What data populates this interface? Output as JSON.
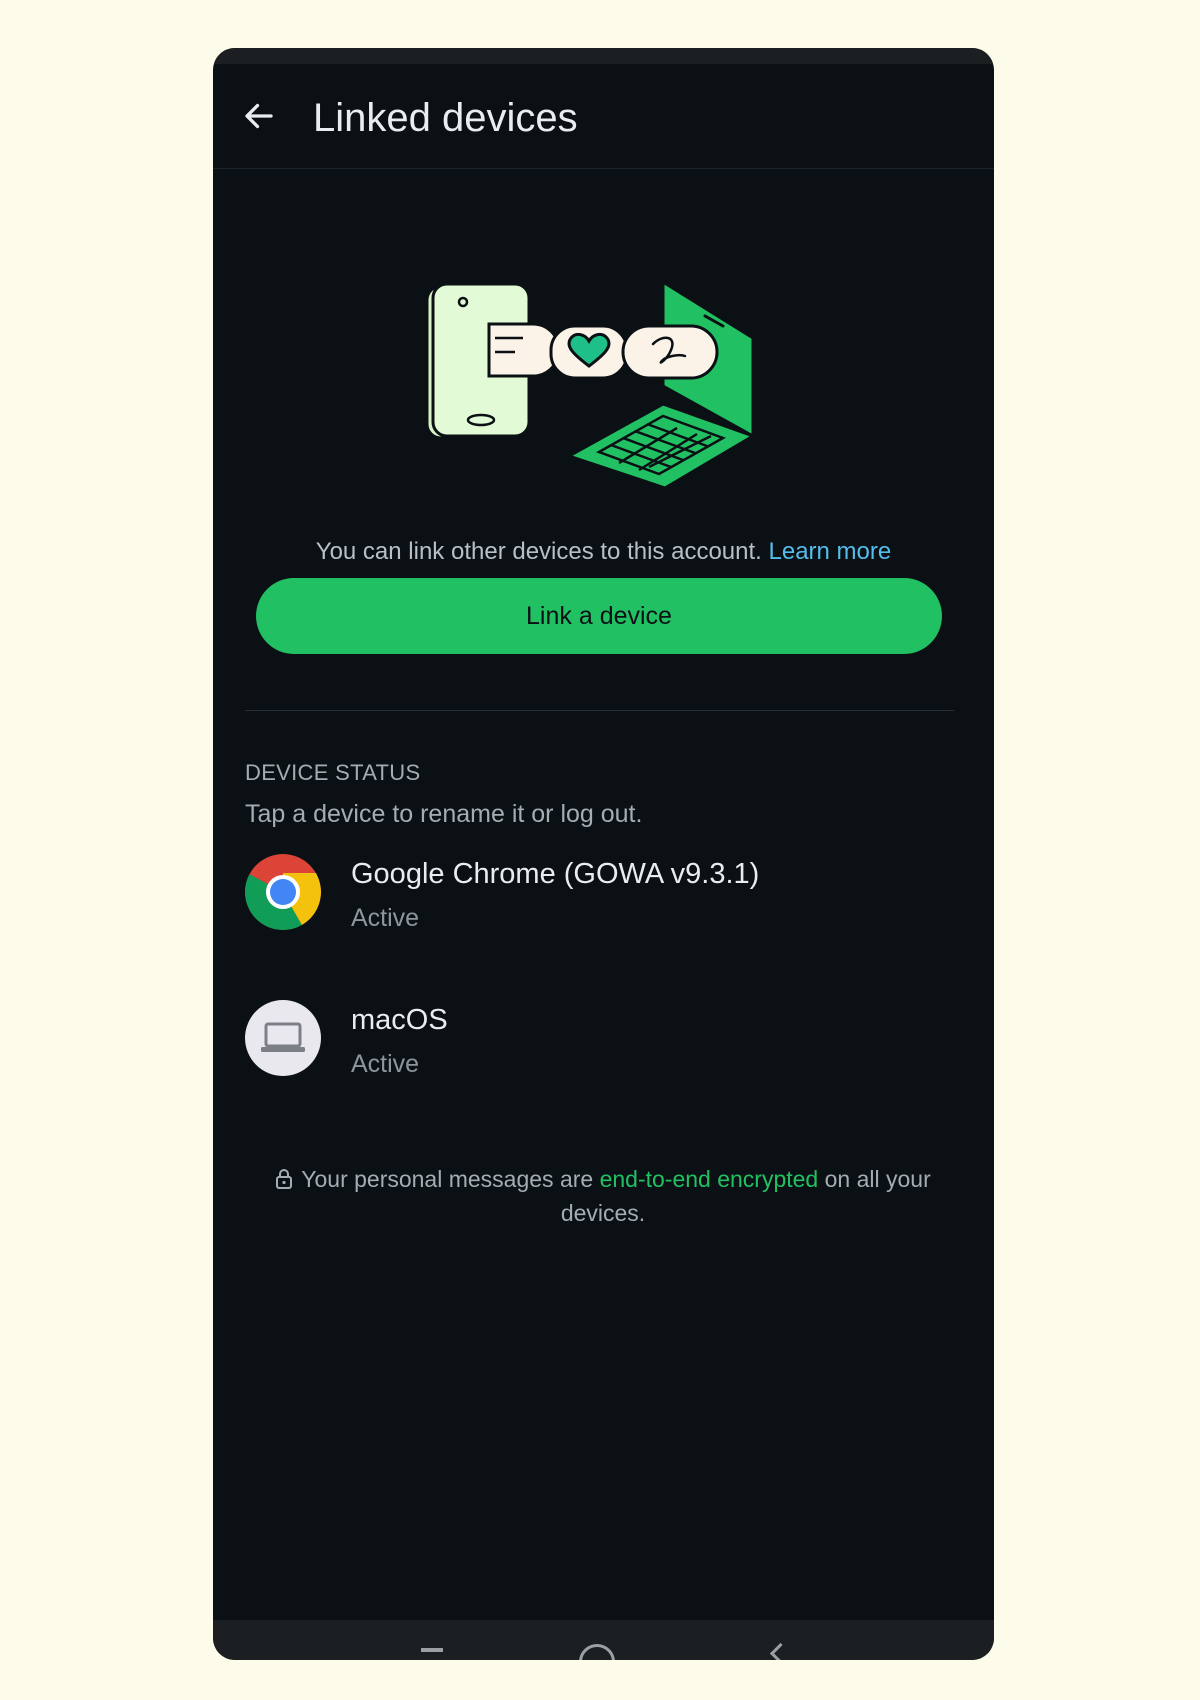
{
  "header": {
    "title": "Linked devices",
    "back_icon": "arrow-left-icon"
  },
  "hero": {
    "illustration": "phone-laptop-linking-illustration"
  },
  "intro": {
    "text": "You can link other devices to this account.",
    "link_label": "Learn more"
  },
  "primary_action": {
    "label": "Link a device"
  },
  "device_status": {
    "heading": "DEVICE STATUS",
    "subtitle": "Tap a device to rename it or log out.",
    "devices": [
      {
        "name": "Google Chrome (GOWA v9.3.1)",
        "status": "Active",
        "icon": "chrome-icon"
      },
      {
        "name": "macOS",
        "status": "Active",
        "icon": "laptop-icon"
      }
    ]
  },
  "footer_note": {
    "prefix": "Your personal messages are",
    "link": "end-to-end encrypted",
    "suffix": "on all your devices.",
    "icon": "lock-icon"
  },
  "colors": {
    "background": "#0b1014",
    "accent_green": "#21c063",
    "link_blue": "#53bdeb",
    "text_primary": "#e9edef",
    "text_secondary": "#a4adb2"
  }
}
